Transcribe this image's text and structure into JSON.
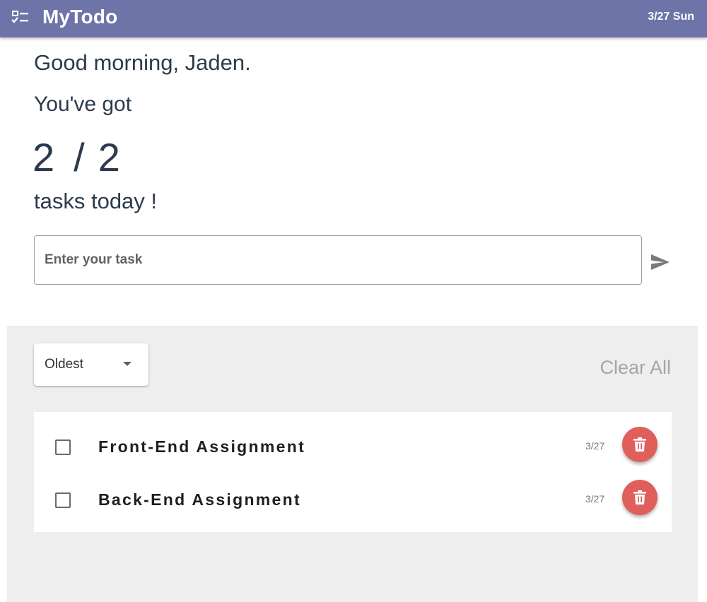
{
  "app": {
    "title": "MyTodo",
    "date": "3/27 Sun"
  },
  "hero": {
    "greeting": "Good morning, Jaden.",
    "lead": "You've got",
    "remaining": "2",
    "separator": "/",
    "total": "2",
    "tail": "tasks today !"
  },
  "task_input": {
    "placeholder": "Enter your task",
    "value": ""
  },
  "sort": {
    "selected": "Oldest"
  },
  "actions": {
    "clear_all": "Clear All"
  },
  "todos": [
    {
      "title": "Front-End Assignment",
      "date": "3/27",
      "checked": false
    },
    {
      "title": "Back-End Assignment",
      "date": "3/27",
      "checked": false
    }
  ],
  "colors": {
    "appbar": "#6f74a8",
    "delete_button": "#e15f5a",
    "list_background": "#eeeeee",
    "text": "#2c3a4c"
  },
  "icons": {
    "app": "checklist-icon",
    "send": "send-icon",
    "sort_caret": "caret-down-icon",
    "delete": "trash-icon"
  }
}
